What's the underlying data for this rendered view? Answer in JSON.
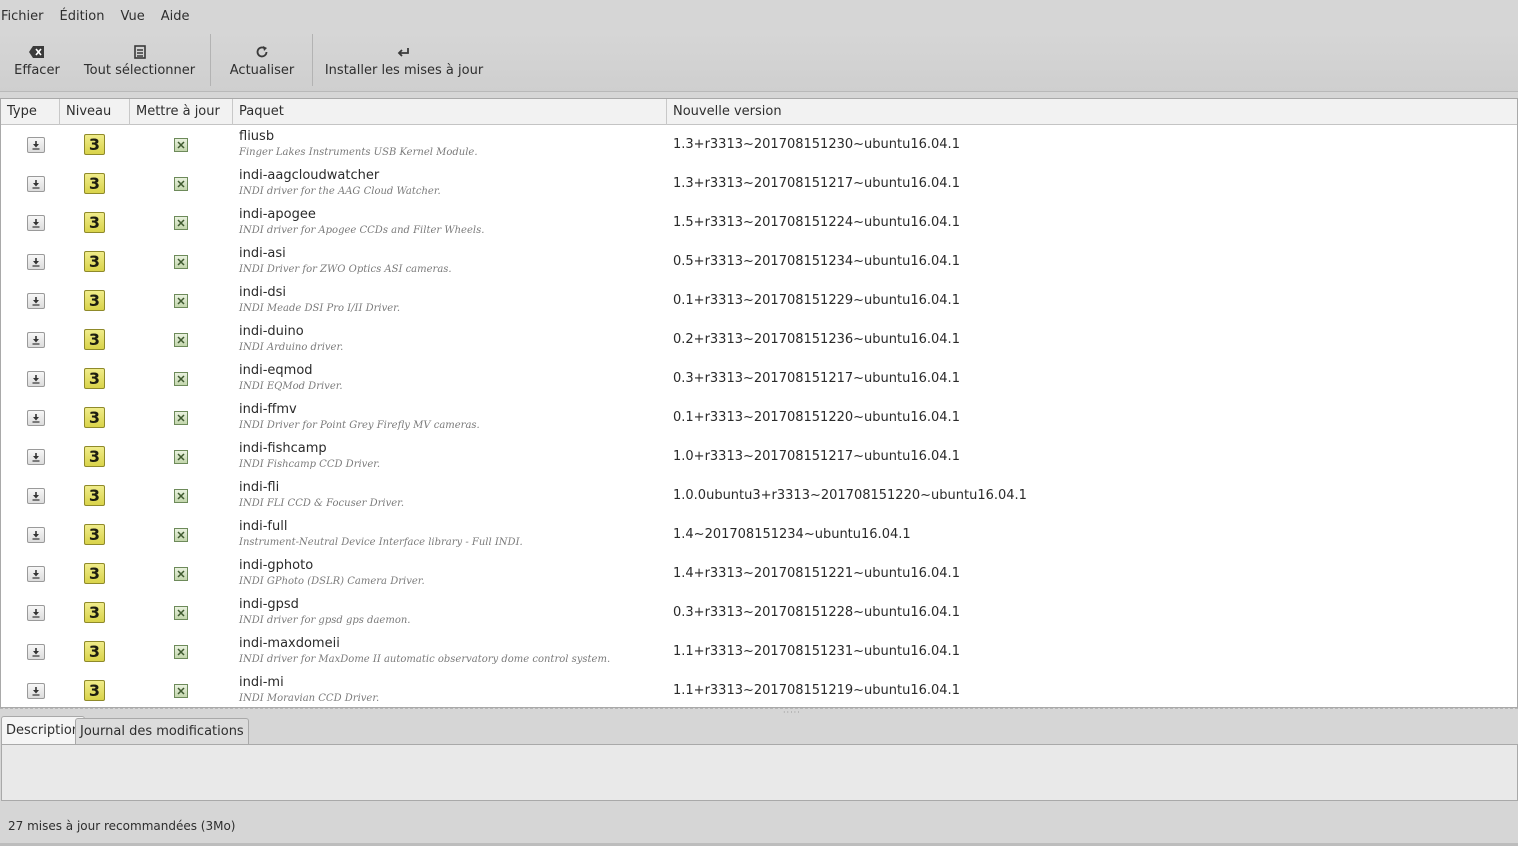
{
  "menu": [
    "Fichier",
    "Édition",
    "Vue",
    "Aide"
  ],
  "toolbar": {
    "clear_label": "Effacer",
    "select_all_label": "Tout sélectionner",
    "refresh_label": "Actualiser",
    "install_label": "Installer les mises à jour"
  },
  "columns": {
    "type": "Type",
    "level": "Niveau",
    "update": "Mettre à jour",
    "package": "Paquet",
    "version": "Nouvelle version"
  },
  "updates": [
    {
      "type": "package-icon",
      "level": "3",
      "checked": true,
      "name": "fliusb",
      "desc": "Finger Lakes Instruments USB Kernel Module.",
      "version": "1.3+r3313~201708151230~ubuntu16.04.1"
    },
    {
      "type": "package-icon",
      "level": "3",
      "checked": true,
      "name": "indi-aagcloudwatcher",
      "desc": "INDI driver for the AAG Cloud Watcher.",
      "version": "1.3+r3313~201708151217~ubuntu16.04.1"
    },
    {
      "type": "package-icon",
      "level": "3",
      "checked": true,
      "name": "indi-apogee",
      "desc": "INDI driver for Apogee CCDs and Filter Wheels.",
      "version": "1.5+r3313~201708151224~ubuntu16.04.1"
    },
    {
      "type": "package-icon",
      "level": "3",
      "checked": true,
      "name": "indi-asi",
      "desc": "INDI Driver for ZWO Optics ASI cameras.",
      "version": "0.5+r3313~201708151234~ubuntu16.04.1"
    },
    {
      "type": "package-icon",
      "level": "3",
      "checked": true,
      "name": "indi-dsi",
      "desc": "INDI Meade DSI Pro I/II Driver.",
      "version": "0.1+r3313~201708151229~ubuntu16.04.1"
    },
    {
      "type": "package-icon",
      "level": "3",
      "checked": true,
      "name": "indi-duino",
      "desc": "INDI Arduino driver.",
      "version": "0.2+r3313~201708151236~ubuntu16.04.1"
    },
    {
      "type": "package-icon",
      "level": "3",
      "checked": true,
      "name": "indi-eqmod",
      "desc": "INDI EQMod Driver.",
      "version": "0.3+r3313~201708151217~ubuntu16.04.1"
    },
    {
      "type": "package-icon",
      "level": "3",
      "checked": true,
      "name": "indi-ffmv",
      "desc": "INDI Driver for Point Grey Firefly MV cameras.",
      "version": "0.1+r3313~201708151220~ubuntu16.04.1"
    },
    {
      "type": "package-icon",
      "level": "3",
      "checked": true,
      "name": "indi-fishcamp",
      "desc": "INDI Fishcamp CCD Driver.",
      "version": "1.0+r3313~201708151217~ubuntu16.04.1"
    },
    {
      "type": "package-icon",
      "level": "3",
      "checked": true,
      "name": "indi-fli",
      "desc": "INDI FLI CCD & Focuser Driver.",
      "version": "1.0.0ubuntu3+r3313~201708151220~ubuntu16.04.1"
    },
    {
      "type": "package-icon",
      "level": "3",
      "checked": true,
      "name": "indi-full",
      "desc": "Instrument-Neutral Device Interface library - Full INDI.",
      "version": "1.4~201708151234~ubuntu16.04.1"
    },
    {
      "type": "package-icon",
      "level": "3",
      "checked": true,
      "name": "indi-gphoto",
      "desc": "INDI GPhoto (DSLR) Camera Driver.",
      "version": "1.4+r3313~201708151221~ubuntu16.04.1"
    },
    {
      "type": "package-icon",
      "level": "3",
      "checked": true,
      "name": "indi-gpsd",
      "desc": "INDI driver for gpsd gps daemon.",
      "version": "0.3+r3313~201708151228~ubuntu16.04.1"
    },
    {
      "type": "package-icon",
      "level": "3",
      "checked": true,
      "name": "indi-maxdomeii",
      "desc": "INDI driver for MaxDome II automatic observatory dome control system.",
      "version": "1.1+r3313~201708151231~ubuntu16.04.1"
    },
    {
      "type": "package-icon",
      "level": "3",
      "checked": true,
      "name": "indi-mi",
      "desc": "INDI Moravian CCD Driver.",
      "version": "1.1+r3313~201708151219~ubuntu16.04.1"
    }
  ],
  "tabs": {
    "description": "Description",
    "changelog": "Journal des modifications"
  },
  "status": "27 mises à jour recommandées (3Mo)",
  "colors": {
    "window_bg": "#d6d6d6",
    "list_bg": "#ffffff",
    "level_badge": "#e3dd5a",
    "checkbox": "#c3d6ad"
  }
}
